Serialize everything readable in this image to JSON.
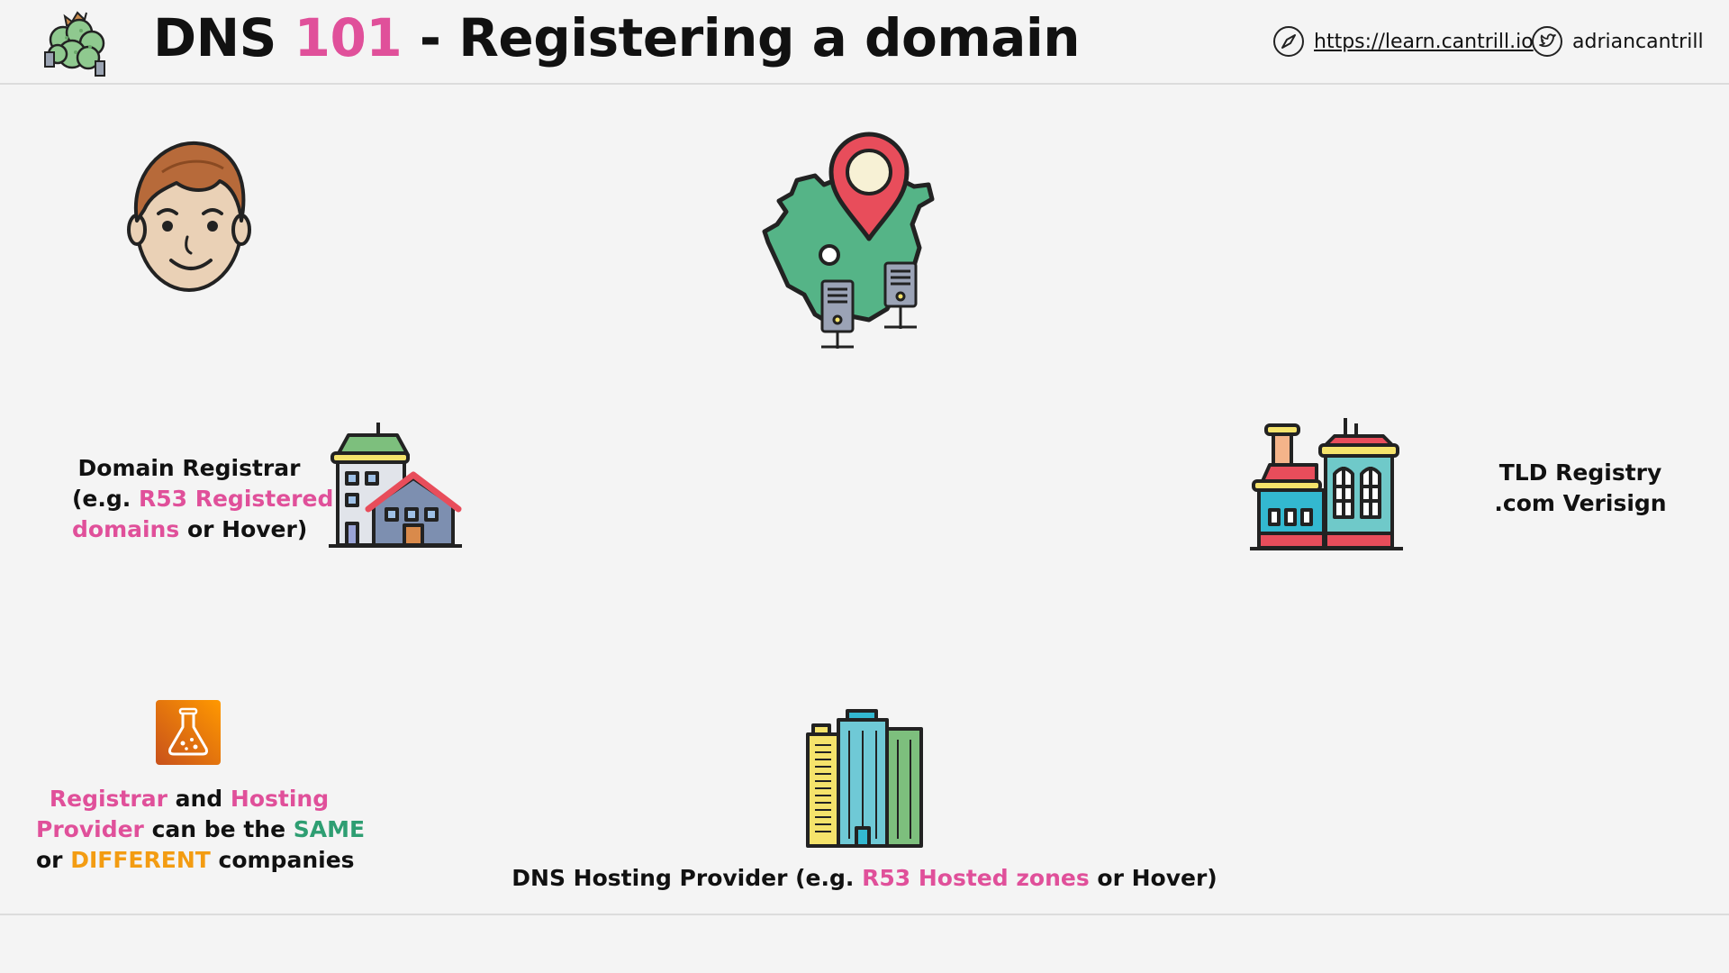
{
  "header": {
    "title_prefix": "DNS ",
    "title_number": "101",
    "title_suffix": " - Registering a domain",
    "website": "https://learn.cantrill.io",
    "twitter": "adriancantrill",
    "icons": [
      "logo-icon",
      "compass-icon",
      "twitter-icon"
    ]
  },
  "nodes": {
    "user": {
      "icon": "person-icon"
    },
    "dns": {
      "icon": "map-pin-servers-icon"
    },
    "registrar": {
      "icon": "buildings-icon",
      "line1": "Domain Registrar",
      "line2_prefix": "(e.g. ",
      "line2_highlight": "R53 Registered",
      "line3_highlight": "domains",
      "line3_suffix": " or Hover)"
    },
    "tld": {
      "icon": "registry-building-icon",
      "line1": "TLD Registry",
      "line2": ".com Verisign"
    },
    "hosting": {
      "icon": "skyscrapers-icon",
      "prefix": "DNS Hosting Provider (e.g. ",
      "highlight": "R53 Hosted zones",
      "suffix": " or Hover)"
    },
    "note": {
      "icon": "flask-icon",
      "w1": "Registrar",
      "w2": " and ",
      "w3": "Hosting",
      "w4": "Provider",
      "w5": " can be the ",
      "w6": "SAME",
      "w7": "or ",
      "w8": "DIFFERENT",
      "w9": " companies"
    }
  },
  "colors": {
    "accent_pink": "#e0509a",
    "accent_green": "#2e9e72",
    "accent_orange": "#f39c12",
    "background": "#f4f4f4"
  }
}
